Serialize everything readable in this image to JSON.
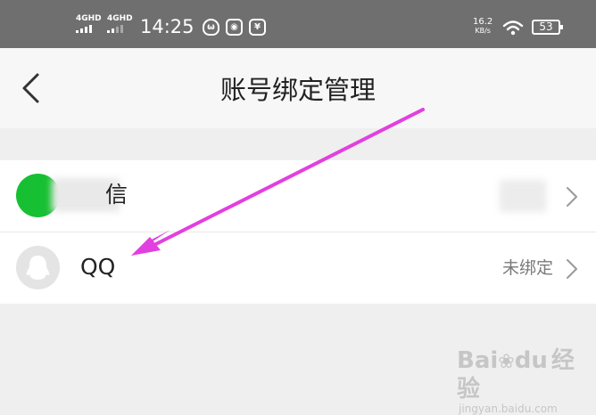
{
  "status_bar": {
    "signal_1": "4GHD",
    "signal_2": "4GHD",
    "time": "14:25",
    "net_speed_value": "16.2",
    "net_speed_unit": "KB/s",
    "battery": "53",
    "icons": [
      "cat-app-icon",
      "box-app-icon",
      "pay-app-icon",
      "wifi-icon"
    ]
  },
  "header": {
    "title": "账号绑定管理",
    "back_icon": "chevron-left-icon"
  },
  "accounts": [
    {
      "label": "信",
      "status": "",
      "avatar_color": "#17c033"
    },
    {
      "label": "QQ",
      "status": "未绑定",
      "avatar_color": "#e4e4e4"
    }
  ],
  "annotation": {
    "arrow_color": "#e23fe0"
  },
  "watermark": {
    "brand": "Bai",
    "paw": "du",
    "name": "经验",
    "url": "jingyan.baidu.com"
  }
}
